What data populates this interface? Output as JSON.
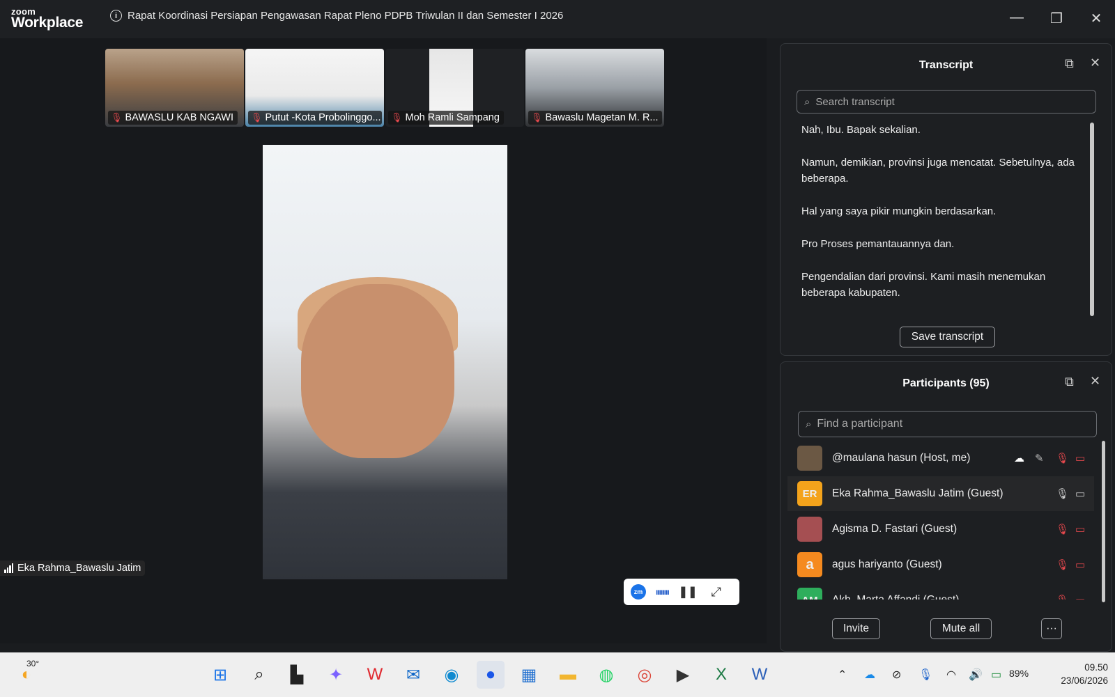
{
  "app": {
    "brand_top": "zoom",
    "brand_bottom": "Workplace",
    "meeting_title": "Rapat Koordinasi Persiapan Pengawasan Rapat Pleno PDPB Triwulan II dan Semester I 2026"
  },
  "window_controls": {
    "minimize": "—",
    "restore": "❐",
    "close": "✕"
  },
  "thumbnails": [
    {
      "name": "BAWASLU KAB NGAWI"
    },
    {
      "name": "Putut -Kota Probolinggo..."
    },
    {
      "name": "Moh Ramli Sampang"
    },
    {
      "name": "Bawaslu Magetan M. R..."
    }
  ],
  "active_speaker": {
    "name": "Eka Rahma_Bawaslu Jatim"
  },
  "transcript": {
    "title": "Transcript",
    "search_placeholder": "Search transcript",
    "lines": [
      "Nah, Ibu. Bapak sekalian.",
      "Namun, demikian, provinsi juga mencatat. Sebetulnya, ada beberapa.",
      "Hal yang saya pikir mungkin berdasarkan.",
      "Pro Proses pemantauannya dan.",
      "Pengendalian dari provinsi. Kami masih menemukan beberapa kabupaten."
    ],
    "save_label": "Save transcript"
  },
  "participants": {
    "title": "Participants (95)",
    "search_placeholder": "Find a participant",
    "list": [
      {
        "name": "@maulana hasun (Host, me)",
        "initials": "",
        "avatar_color": "#6b5844"
      },
      {
        "name": "Eka Rahma_Bawaslu Jatim (Guest)",
        "initials": "ER",
        "avatar_color": "#f4a31b"
      },
      {
        "name": "Agisma D. Fastari (Guest)",
        "initials": "",
        "avatar_color": "#a54f52"
      },
      {
        "name": "agus hariyanto (Guest)",
        "initials": "a",
        "avatar_color": "#f58a1f"
      },
      {
        "name": "Akh. Marta Affandi (Guest)",
        "initials": "AM",
        "avatar_color": "#2eae5c"
      }
    ],
    "invite_label": "Invite",
    "mute_all_label": "Mute all",
    "more_label": "···"
  },
  "floatbar": {
    "logo": "zm"
  },
  "taskbar": {
    "weather_temp": "30°",
    "battery": "89%",
    "time": "09.50",
    "date": "23/06/2026"
  }
}
